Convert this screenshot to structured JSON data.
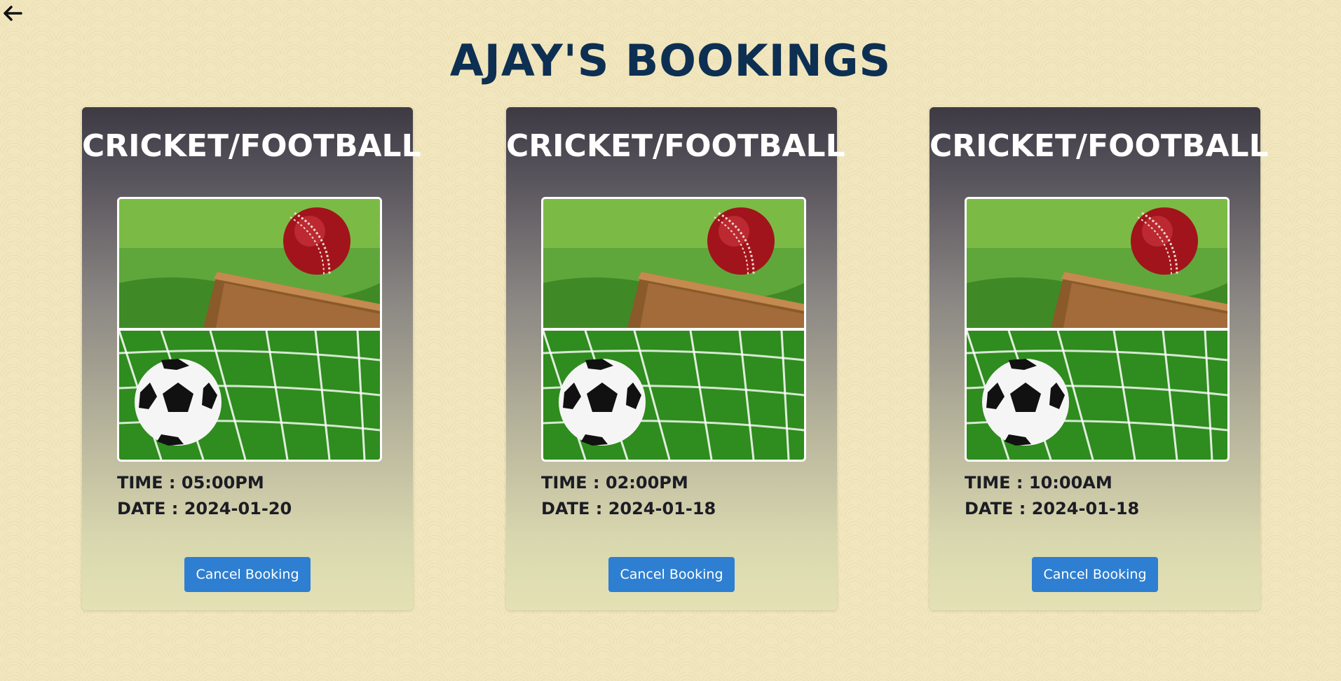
{
  "header": {
    "back_icon": "arrow-left-icon",
    "title": "AJAY'S BOOKINGS"
  },
  "bookings": [
    {
      "sport": "CRICKET/FOOTBALL",
      "time_label": "TIME : 05:00PM",
      "date_label": "DATE : 2024-01-20",
      "cancel_label": "Cancel Booking"
    },
    {
      "sport": "CRICKET/FOOTBALL",
      "time_label": "TIME : 02:00PM",
      "date_label": "DATE : 2024-01-18",
      "cancel_label": "Cancel Booking"
    },
    {
      "sport": "CRICKET/FOOTBALL",
      "time_label": "TIME : 10:00AM",
      "date_label": "DATE : 2024-01-18",
      "cancel_label": "Cancel Booking"
    }
  ],
  "colors": {
    "title": "#0d2f52",
    "button": "#2e7fd1",
    "page_background": "#f1e6be"
  }
}
